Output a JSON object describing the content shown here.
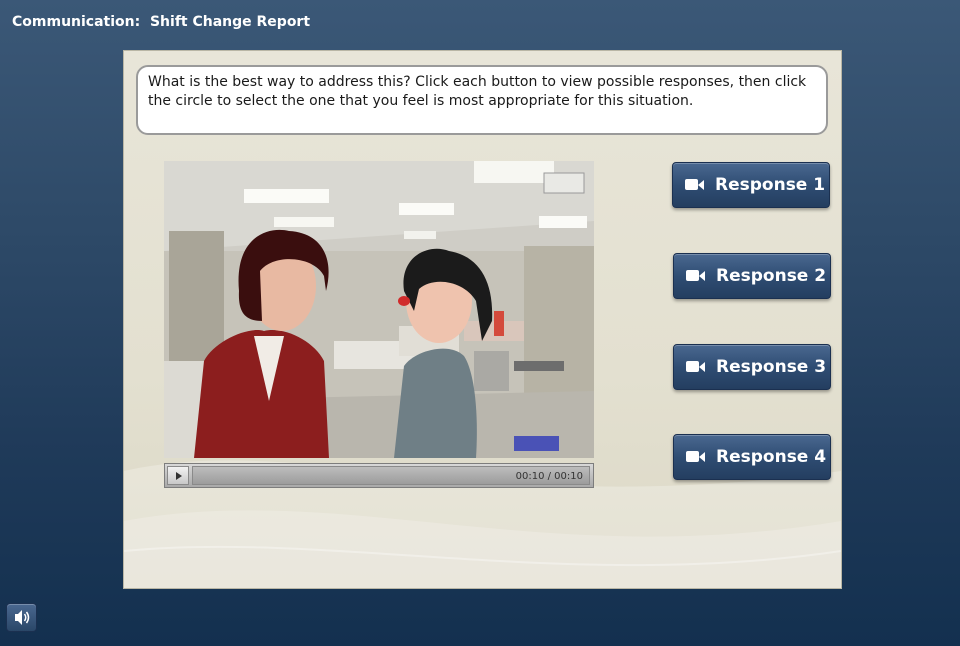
{
  "header": {
    "title": "Communication:  Shift Change Report"
  },
  "prompt": {
    "text": "What is the best way to address this?  Click each button to view possible responses, then click the circle to select the one that you feel is most appropriate for this situation."
  },
  "video": {
    "time": "00:10 / 00:10",
    "play_icon": "play-icon"
  },
  "responses": [
    {
      "label": "Response 1",
      "icon": "video-camera-icon"
    },
    {
      "label": "Response 2",
      "icon": "video-camera-icon"
    },
    {
      "label": "Response 3",
      "icon": "video-camera-icon"
    },
    {
      "label": "Response 4",
      "icon": "video-camera-icon"
    }
  ],
  "audio": {
    "icon": "speaker-icon"
  },
  "colors": {
    "background": "#2e4a68",
    "slide": "#e5e2d4",
    "button": "#2f4d73"
  }
}
